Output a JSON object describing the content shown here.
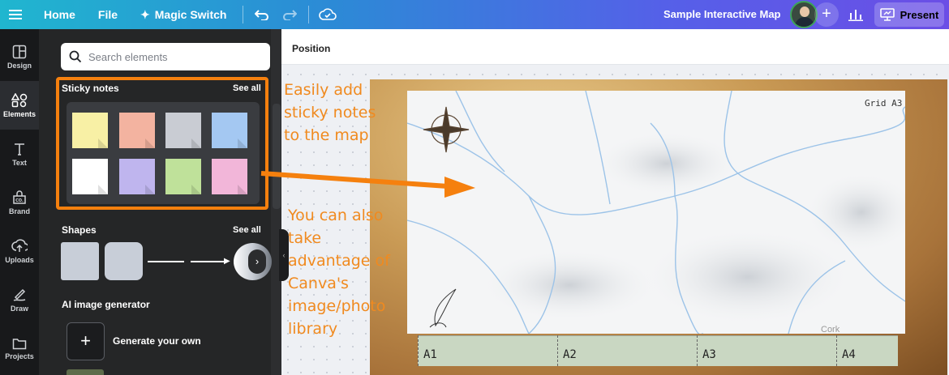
{
  "topbar": {
    "menu_icon": "hamburger-icon",
    "home": "Home",
    "file": "File",
    "magic_switch": "Magic Switch",
    "title": "Sample Interactive Map",
    "present": "Present"
  },
  "rail": {
    "items": [
      {
        "label": "Design",
        "icon": "design-icon"
      },
      {
        "label": "Elements",
        "icon": "elements-icon"
      },
      {
        "label": "Text",
        "icon": "text-icon"
      },
      {
        "label": "Brand",
        "icon": "brand-icon"
      },
      {
        "label": "Uploads",
        "icon": "uploads-icon"
      },
      {
        "label": "Draw",
        "icon": "draw-icon"
      },
      {
        "label": "Projects",
        "icon": "projects-icon"
      }
    ]
  },
  "panel": {
    "search_placeholder": "Search elements",
    "sticky_title": "Sticky notes",
    "sticky_see_all": "See all",
    "sticky_colors": [
      "#f8f0a5",
      "#f3b3a0",
      "#c9ccd3",
      "#a4c8f2",
      "#ffffff",
      "#bfb5ee",
      "#bfe19a",
      "#f2b6d9"
    ],
    "shapes_title": "Shapes",
    "shapes_see_all": "See all",
    "ai_title": "AI image generator",
    "generate_label": "Generate your own"
  },
  "canvas": {
    "position_label": "Position",
    "grid_label": "Grid A3",
    "strip_labels": [
      "A1",
      "A2",
      "A3",
      "A4"
    ],
    "map_place_label": "Cork"
  },
  "annotations": {
    "note1": "Easily add sticky notes to the map",
    "note2": "You can also take advantage of Canva's image/photo library"
  },
  "colors": {
    "accent_orange": "#f5800e",
    "annotation_text": "#f08a1f"
  }
}
